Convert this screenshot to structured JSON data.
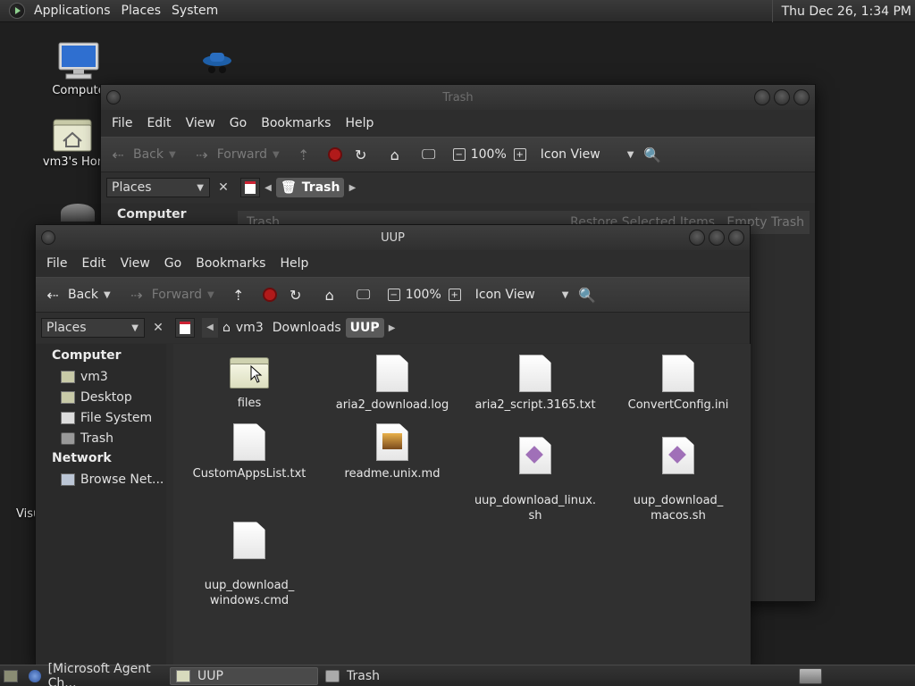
{
  "top_panel": {
    "menus": [
      "Applications",
      "Places",
      "System"
    ],
    "clock": "Thu Dec 26,  1:34 PM"
  },
  "desktop": {
    "icons": [
      {
        "label": "Compute"
      },
      {
        "label": "vm3's Hor"
      },
      {
        "label": "Visu"
      }
    ]
  },
  "trash_window": {
    "title": "Trash",
    "menus": [
      "File",
      "Edit",
      "View",
      "Go",
      "Bookmarks",
      "Help"
    ],
    "toolbar": {
      "back": "Back",
      "forward": "Forward",
      "zoom": "100%",
      "view": "Icon View"
    },
    "places_label": "Places",
    "crumb": "Trash",
    "sidebar_head": "Computer",
    "info_title": "Trash",
    "restore": "Restore Selected Items",
    "empty": "Empty Trash"
  },
  "uup_window": {
    "title": "UUP",
    "menus": [
      "File",
      "Edit",
      "View",
      "Go",
      "Bookmarks",
      "Help"
    ],
    "toolbar": {
      "back": "Back",
      "forward": "Forward",
      "zoom": "100%",
      "view": "Icon View"
    },
    "places_label": "Places",
    "breadcrumbs": [
      "vm3",
      "Downloads",
      "UUP"
    ],
    "sidebar": {
      "computer_head": "Computer",
      "computer_items": [
        "vm3",
        "Desktop",
        "File System",
        "Trash"
      ],
      "network_head": "Network",
      "network_items": [
        "Browse Net..."
      ]
    },
    "files": [
      {
        "name": "files",
        "type": "folder"
      },
      {
        "name": "aria2_download.log",
        "type": "doc"
      },
      {
        "name": "aria2_script.3165.txt",
        "type": "doc"
      },
      {
        "name": "ConvertConfig.ini",
        "type": "doc"
      },
      {
        "name": "CustomAppsList.txt",
        "type": "doc"
      },
      {
        "name": "readme.unix.md",
        "type": "img"
      },
      {
        "name": "uup_download_linux.\nsh",
        "type": "sh"
      },
      {
        "name": "uup_download_\nmacos.sh",
        "type": "sh"
      },
      {
        "name": "uup_download_\nwindows.cmd",
        "type": "doc"
      }
    ]
  },
  "taskbar": {
    "tasks": [
      "[Microsoft Agent Ch...",
      "UUP",
      "Trash"
    ]
  }
}
